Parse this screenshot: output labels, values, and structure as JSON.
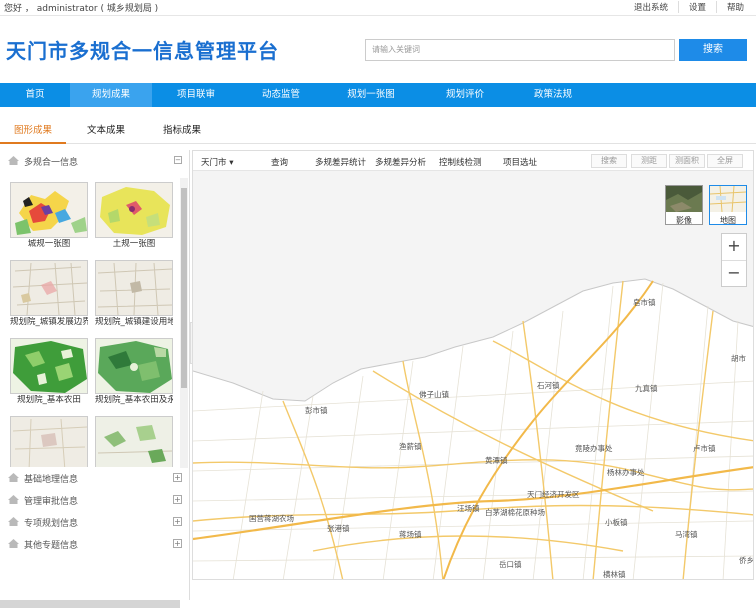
{
  "topbar": {
    "greeting": "您好 ， administrator ( 城乡规划局 )",
    "logout": "退出系统",
    "settings": "设置",
    "help": "帮助"
  },
  "header": {
    "title": "天门市多规合一信息管理平台",
    "search_placeholder": "请输入关键词",
    "search_button": "搜索"
  },
  "nav": {
    "items": [
      {
        "label": "首页"
      },
      {
        "label": "规划成果"
      },
      {
        "label": "项目联审"
      },
      {
        "label": "动态监管"
      },
      {
        "label": "规划一张图"
      },
      {
        "label": "规划评价"
      },
      {
        "label": "政策法规"
      }
    ]
  },
  "tabs": [
    {
      "label": "图形成果"
    },
    {
      "label": "文本成果"
    },
    {
      "label": "指标成果"
    }
  ],
  "sidebar": {
    "header": "多规合一信息",
    "header_toggle": "−",
    "thumbnails": [
      {
        "caption": "城规一张图"
      },
      {
        "caption": "土规一张图"
      },
      {
        "caption": "规划院_城镇发展边界"
      },
      {
        "caption": "规划院_城镇建设用地规划"
      },
      {
        "caption": "规划院_基本农田"
      },
      {
        "caption": "规划院_基本农田及永久基本农田"
      },
      {
        "caption": ""
      },
      {
        "caption": ""
      }
    ],
    "sections": [
      {
        "label": "基础地理信息",
        "toggle": "+"
      },
      {
        "label": "管理审批信息",
        "toggle": "+"
      },
      {
        "label": "专项规划信息",
        "toggle": "+"
      },
      {
        "label": "其他专题信息",
        "toggle": "+"
      }
    ]
  },
  "map": {
    "city_select": "天门市 ▾",
    "tools": [
      "查询",
      "多规差异统计",
      "多规差异分析",
      "控制线检测",
      "项目选址"
    ],
    "right_buttons": [
      "搜索",
      "测距",
      "测面积",
      "全屏"
    ],
    "layers": [
      {
        "label": "影像"
      },
      {
        "label": "地图"
      }
    ],
    "zoom_in": "+",
    "zoom_out": "−",
    "place_labels": [
      "皂市镇",
      "石河镇",
      "九真镇",
      "胡市",
      "佛子山镇",
      "卢市镇",
      "彭市镇",
      "渔薪镇",
      "黄潭镇",
      "竟陵办事处",
      "杨林办事处",
      "天门经济开发区",
      "汪场镇",
      "白茅湖棉花原种场",
      "国营蒋湖农场",
      "张港镇",
      "蒋场镇",
      "小板镇",
      "马湾镇",
      "岳口镇",
      "横林镇",
      "侨乡街道"
    ]
  },
  "colors": {
    "brand": "#1a6fd0",
    "nav_bg": "#0b8ee5",
    "nav_active": "#3aa3ee",
    "tab_active": "#e07a1f",
    "search_btn": "#1e8be8"
  }
}
